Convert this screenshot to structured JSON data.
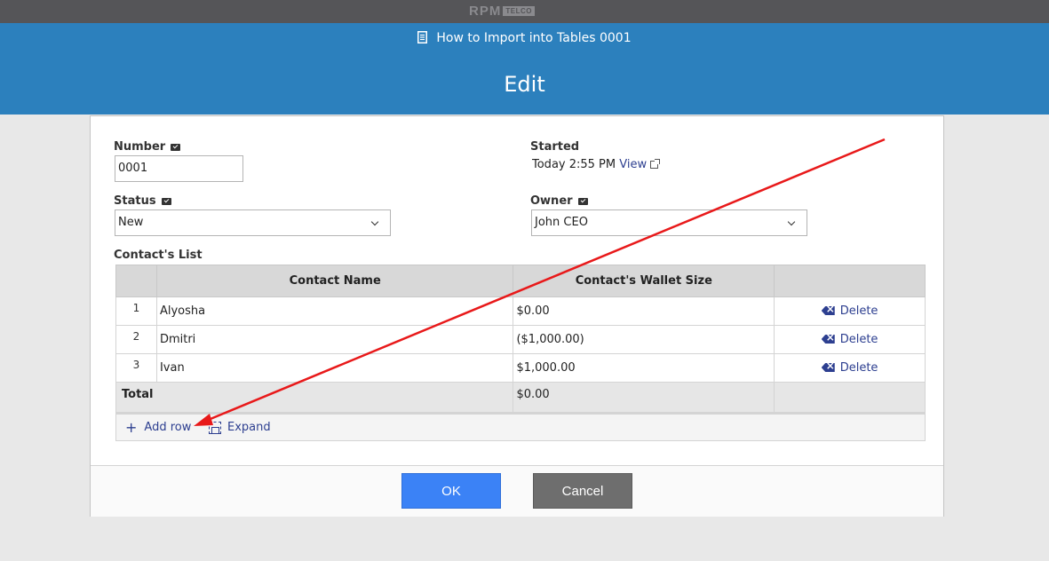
{
  "brand": {
    "name": "RPM",
    "tag": "TELCO"
  },
  "header": {
    "record_title": "How to Import into Tables 0001",
    "page_title": "Edit"
  },
  "form": {
    "number": {
      "label": "Number",
      "value": "0001"
    },
    "started": {
      "label": "Started",
      "value": "Today 2:55 PM",
      "link": "View"
    },
    "status": {
      "label": "Status",
      "value": "New"
    },
    "owner": {
      "label": "Owner",
      "value": "John CEO"
    }
  },
  "contacts": {
    "label": "Contact's List",
    "columns": [
      "Contact Name",
      "Contact's Wallet Size"
    ],
    "rows": [
      {
        "num": "1",
        "name": "Alyosha",
        "wallet": "$0.00",
        "action": "Delete"
      },
      {
        "num": "2",
        "name": "Dmitri",
        "wallet": "($1,000.00)",
        "action": "Delete"
      },
      {
        "num": "3",
        "name": "Ivan",
        "wallet": "$1,000.00",
        "action": "Delete"
      }
    ],
    "total": {
      "label": "Total",
      "value": "$0.00"
    },
    "add_row": "Add row",
    "expand": "Expand"
  },
  "buttons": {
    "ok": "OK",
    "cancel": "Cancel"
  },
  "colors": {
    "header": "#2c80bd",
    "topbar": "#555558",
    "link": "#2d3f90",
    "ok": "#3b82f6",
    "cancel": "#6e6e6e",
    "annotation": "#e8191a"
  }
}
